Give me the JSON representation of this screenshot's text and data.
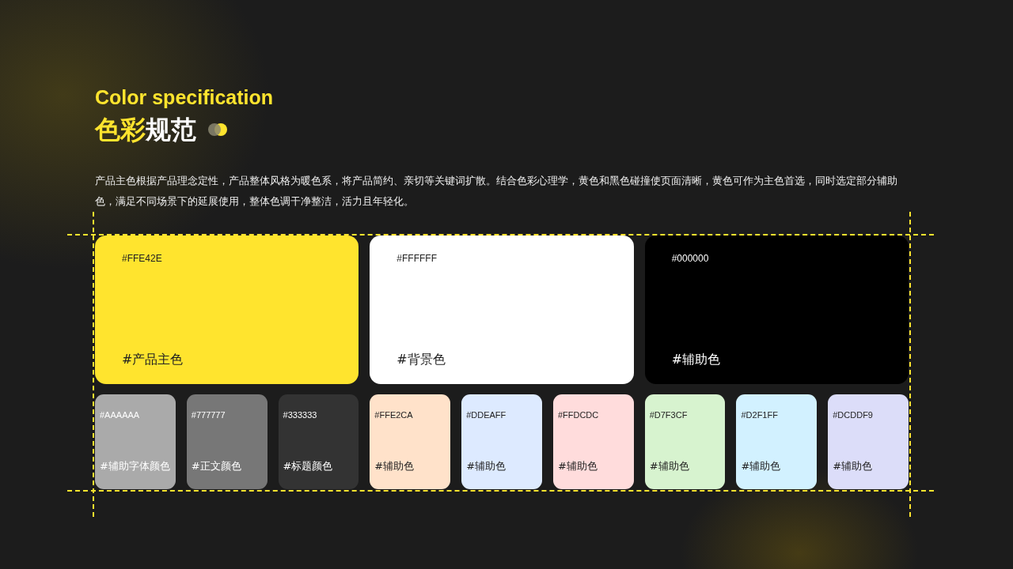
{
  "heading": {
    "subtitle": "Color specification",
    "title_parts": [
      {
        "text": "色彩",
        "accent": true
      },
      {
        "text": "规范",
        "accent": false
      }
    ]
  },
  "description": "产品主色根据产品理念定性，产品整体风格为暖色系，将产品简约、亲切等关键词扩散。结合色彩心理学，黄色和黑色碰撞使页面清晰，黄色可作为主色首选，同时选定部分辅助色，满足不同场景下的延展使用，整体色调干净整洁，活力且年轻化。",
  "main_colors": [
    {
      "hex": "#FFE42E",
      "label": "#产品主色",
      "color": "#ffe42e"
    },
    {
      "hex": "#FFFFFF",
      "label": "#背景色",
      "color": "#ffffff"
    },
    {
      "hex": "#000000",
      "label": "#辅助色",
      "color": "#000000"
    }
  ],
  "secondary_colors": [
    {
      "hex": "#AAAAAA",
      "label": "#辅助字体颜色",
      "color": "#aaaaaa"
    },
    {
      "hex": "#777777",
      "label": "#正文颜色",
      "color": "#777777"
    },
    {
      "hex": "#333333",
      "label": "#标题颜色",
      "color": "#333333"
    },
    {
      "hex": "#FFE2CA",
      "label": "#辅助色",
      "color": "#ffe2ca"
    },
    {
      "hex": "#DDEAFF",
      "label": "#辅助色",
      "color": "#ddeaff"
    },
    {
      "hex": "#FFDCDC",
      "label": "#辅助色",
      "color": "#ffdcdc"
    },
    {
      "hex": "#D7F3CF",
      "label": "#辅助色",
      "color": "#d7f3cf"
    },
    {
      "hex": "#D2F1FF",
      "label": "#辅助色",
      "color": "#d2f1ff"
    },
    {
      "hex": "#DCDDF9",
      "label": "#辅助色",
      "color": "#dcddf9"
    }
  ]
}
